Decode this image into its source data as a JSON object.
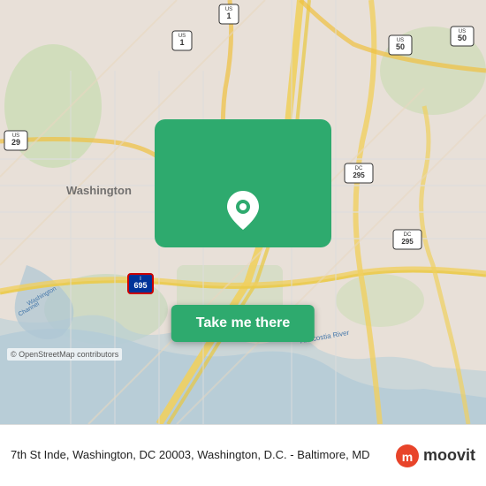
{
  "map": {
    "alt": "Map of Washington D.C. area"
  },
  "panel": {
    "button_label": "Take me there"
  },
  "footer": {
    "address": "7th St Inde, Washington, DC 20003, Washington, D.C. - Baltimore, MD",
    "osm_credit": "© OpenStreetMap contributors",
    "moovit_label": "moovit"
  }
}
